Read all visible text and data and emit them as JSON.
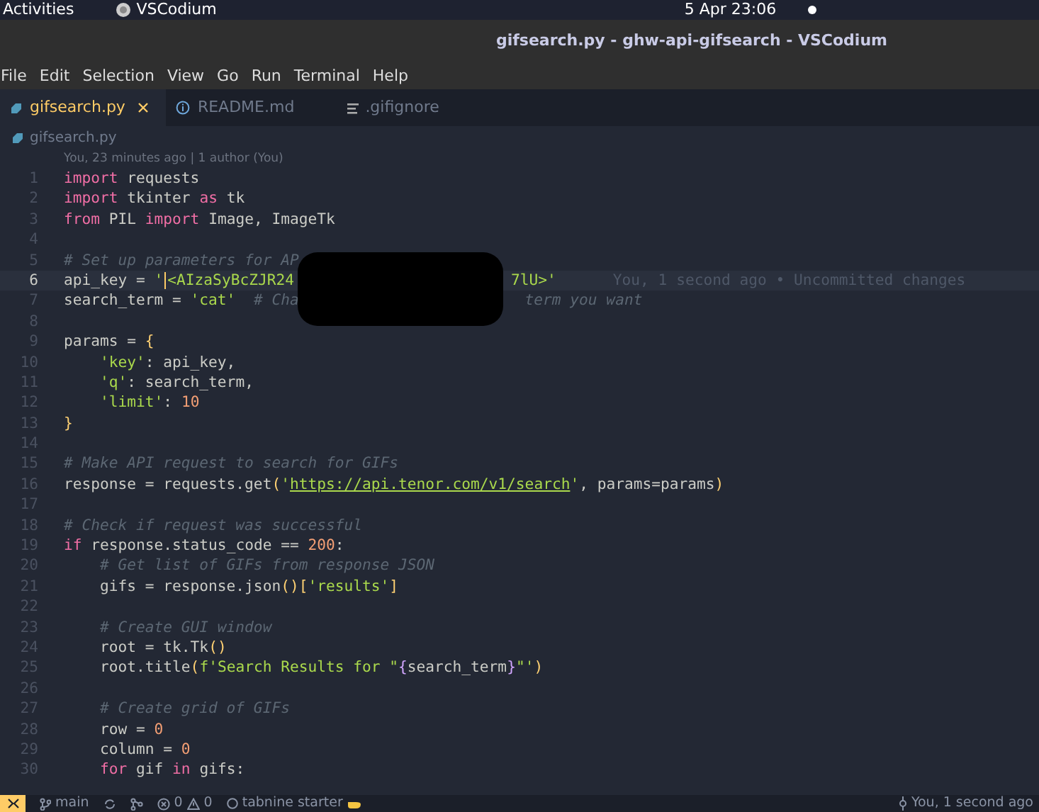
{
  "top_bar": {
    "activities": "Activities",
    "app": "VSCodium",
    "clock": "5 Apr  23:06"
  },
  "window": {
    "title": "gifsearch.py - ghw-api-gifsearch - VSCodium"
  },
  "menu": [
    "File",
    "Edit",
    "Selection",
    "View",
    "Go",
    "Run",
    "Terminal",
    "Help"
  ],
  "tabs": [
    {
      "label": "gifsearch.py",
      "kind": "python",
      "selected": true
    },
    {
      "label": "README.md",
      "kind": "info",
      "selected": false
    },
    {
      "label": ".gifignore",
      "kind": "lines",
      "selected": false
    }
  ],
  "breadcrumb": "gifsearch.py",
  "codelens": "You, 23 minutes ago | 1 author (You)",
  "redaction": true,
  "lines": [
    {
      "number": "1",
      "tokens": [
        {
          "kind": "kw",
          "text": "import"
        },
        {
          "kind": "pl",
          "text": " requests"
        }
      ]
    },
    {
      "number": "2",
      "tokens": [
        {
          "kind": "kw",
          "text": "import"
        },
        {
          "kind": "pl",
          "text": " tkinter "
        },
        {
          "kind": "kw",
          "text": "as"
        },
        {
          "kind": "pl",
          "text": " tk"
        }
      ]
    },
    {
      "number": "3",
      "tokens": [
        {
          "kind": "kw",
          "text": "from"
        },
        {
          "kind": "pl",
          "text": " PIL "
        },
        {
          "kind": "kw",
          "text": "import"
        },
        {
          "kind": "pl",
          "text": " Image, ImageTk"
        }
      ]
    },
    {
      "number": "4"
    },
    {
      "number": "5",
      "tokens": [
        {
          "kind": "cmt",
          "text": "# Set up parameters for AP"
        }
      ]
    },
    {
      "number": "6",
      "current": true,
      "blame": "You, 1 second ago • Uncommitted changes",
      "tokens": [
        {
          "kind": "pl",
          "text": "api_key = "
        },
        {
          "kind": "str",
          "text": "'<AIzaSyBcZJR24"
        },
        {
          "kind": "str",
          "text": "7lU>'",
          "after_gap": true
        }
      ]
    },
    {
      "number": "7",
      "tokens": [
        {
          "kind": "pl",
          "text": "search_term = "
        },
        {
          "kind": "str",
          "text": "'cat'"
        },
        {
          "kind": "cmt",
          "text": "  # Cha"
        },
        {
          "kind": "cmt",
          "text": " term you want",
          "after_gap": true
        }
      ]
    },
    {
      "number": "8"
    },
    {
      "number": "9",
      "tokens": [
        {
          "kind": "pl",
          "text": "params = "
        },
        {
          "kind": "br",
          "text": "{"
        }
      ]
    },
    {
      "number": "10",
      "tokens": [
        {
          "kind": "str",
          "text": "    'key'"
        },
        {
          "kind": "pl",
          "text": ": api_key,"
        }
      ]
    },
    {
      "number": "11",
      "tokens": [
        {
          "kind": "str",
          "text": "    'q'"
        },
        {
          "kind": "pl",
          "text": ": search_term,"
        }
      ]
    },
    {
      "number": "12",
      "tokens": [
        {
          "kind": "str",
          "text": "    'limit'"
        },
        {
          "kind": "pl",
          "text": ": "
        },
        {
          "kind": "num",
          "text": "10"
        }
      ]
    },
    {
      "number": "13",
      "tokens": [
        {
          "kind": "br",
          "text": "}"
        }
      ]
    },
    {
      "number": "14"
    },
    {
      "number": "15",
      "tokens": [
        {
          "kind": "cmt",
          "text": "# Make API request to search for GIFs"
        }
      ]
    },
    {
      "number": "16",
      "tokens": [
        {
          "kind": "pl",
          "text": "response = requests.get"
        },
        {
          "kind": "br",
          "text": "("
        },
        {
          "kind": "str",
          "text": "'"
        },
        {
          "kind": "url",
          "text": "https://api.tenor.com/v1/search"
        },
        {
          "kind": "str",
          "text": "'"
        },
        {
          "kind": "pl",
          "text": ", params=params"
        },
        {
          "kind": "br",
          "text": ")"
        }
      ]
    },
    {
      "number": "17"
    },
    {
      "number": "18",
      "tokens": [
        {
          "kind": "cmt",
          "text": "# Check if request was successful"
        }
      ]
    },
    {
      "number": "19",
      "tokens": [
        {
          "kind": "kw",
          "text": "if"
        },
        {
          "kind": "pl",
          "text": " response.status_code == "
        },
        {
          "kind": "num",
          "text": "200"
        },
        {
          "kind": "pl",
          "text": ":"
        }
      ]
    },
    {
      "number": "20",
      "tokens": [
        {
          "kind": "cmt",
          "text": "    # Get list of GIFs from response JSON"
        }
      ]
    },
    {
      "number": "21",
      "tokens": [
        {
          "kind": "pl",
          "text": "    gifs = response.json"
        },
        {
          "kind": "br",
          "text": "()["
        },
        {
          "kind": "str",
          "text": "'results'"
        },
        {
          "kind": "br",
          "text": "]"
        }
      ]
    },
    {
      "number": "22"
    },
    {
      "number": "23",
      "tokens": [
        {
          "kind": "cmt",
          "text": "    # Create GUI window"
        }
      ]
    },
    {
      "number": "24",
      "tokens": [
        {
          "kind": "pl",
          "text": "    root = tk.Tk"
        },
        {
          "kind": "br",
          "text": "()"
        }
      ]
    },
    {
      "number": "25",
      "tokens": [
        {
          "kind": "pl",
          "text": "    root.title"
        },
        {
          "kind": "br",
          "text": "("
        },
        {
          "kind": "str",
          "text": "f'Search Results for \""
        },
        {
          "kind": "interp",
          "text": "{"
        },
        {
          "kind": "pl",
          "text": "search_term"
        },
        {
          "kind": "interp",
          "text": "}"
        },
        {
          "kind": "str",
          "text": "\"'"
        },
        {
          "kind": "br",
          "text": ")"
        }
      ]
    },
    {
      "number": "26"
    },
    {
      "number": "27",
      "tokens": [
        {
          "kind": "cmt",
          "text": "    # Create grid of GIFs"
        }
      ]
    },
    {
      "number": "28",
      "tokens": [
        {
          "kind": "pl",
          "text": "    row = "
        },
        {
          "kind": "num",
          "text": "0"
        }
      ]
    },
    {
      "number": "29",
      "tokens": [
        {
          "kind": "pl",
          "text": "    column = "
        },
        {
          "kind": "num",
          "text": "0"
        }
      ]
    },
    {
      "number": "30",
      "tokens": [
        {
          "kind": "kw",
          "text": "    for"
        },
        {
          "kind": "pl",
          "text": " gif "
        },
        {
          "kind": "kw",
          "text": "in"
        },
        {
          "kind": "pl",
          "text": " gifs:"
        }
      ]
    }
  ],
  "status_bar": {
    "branch": "main",
    "errors": "0",
    "warnings": "0",
    "tabnine": "tabnine starter",
    "blame": "You, 1 second ago"
  }
}
